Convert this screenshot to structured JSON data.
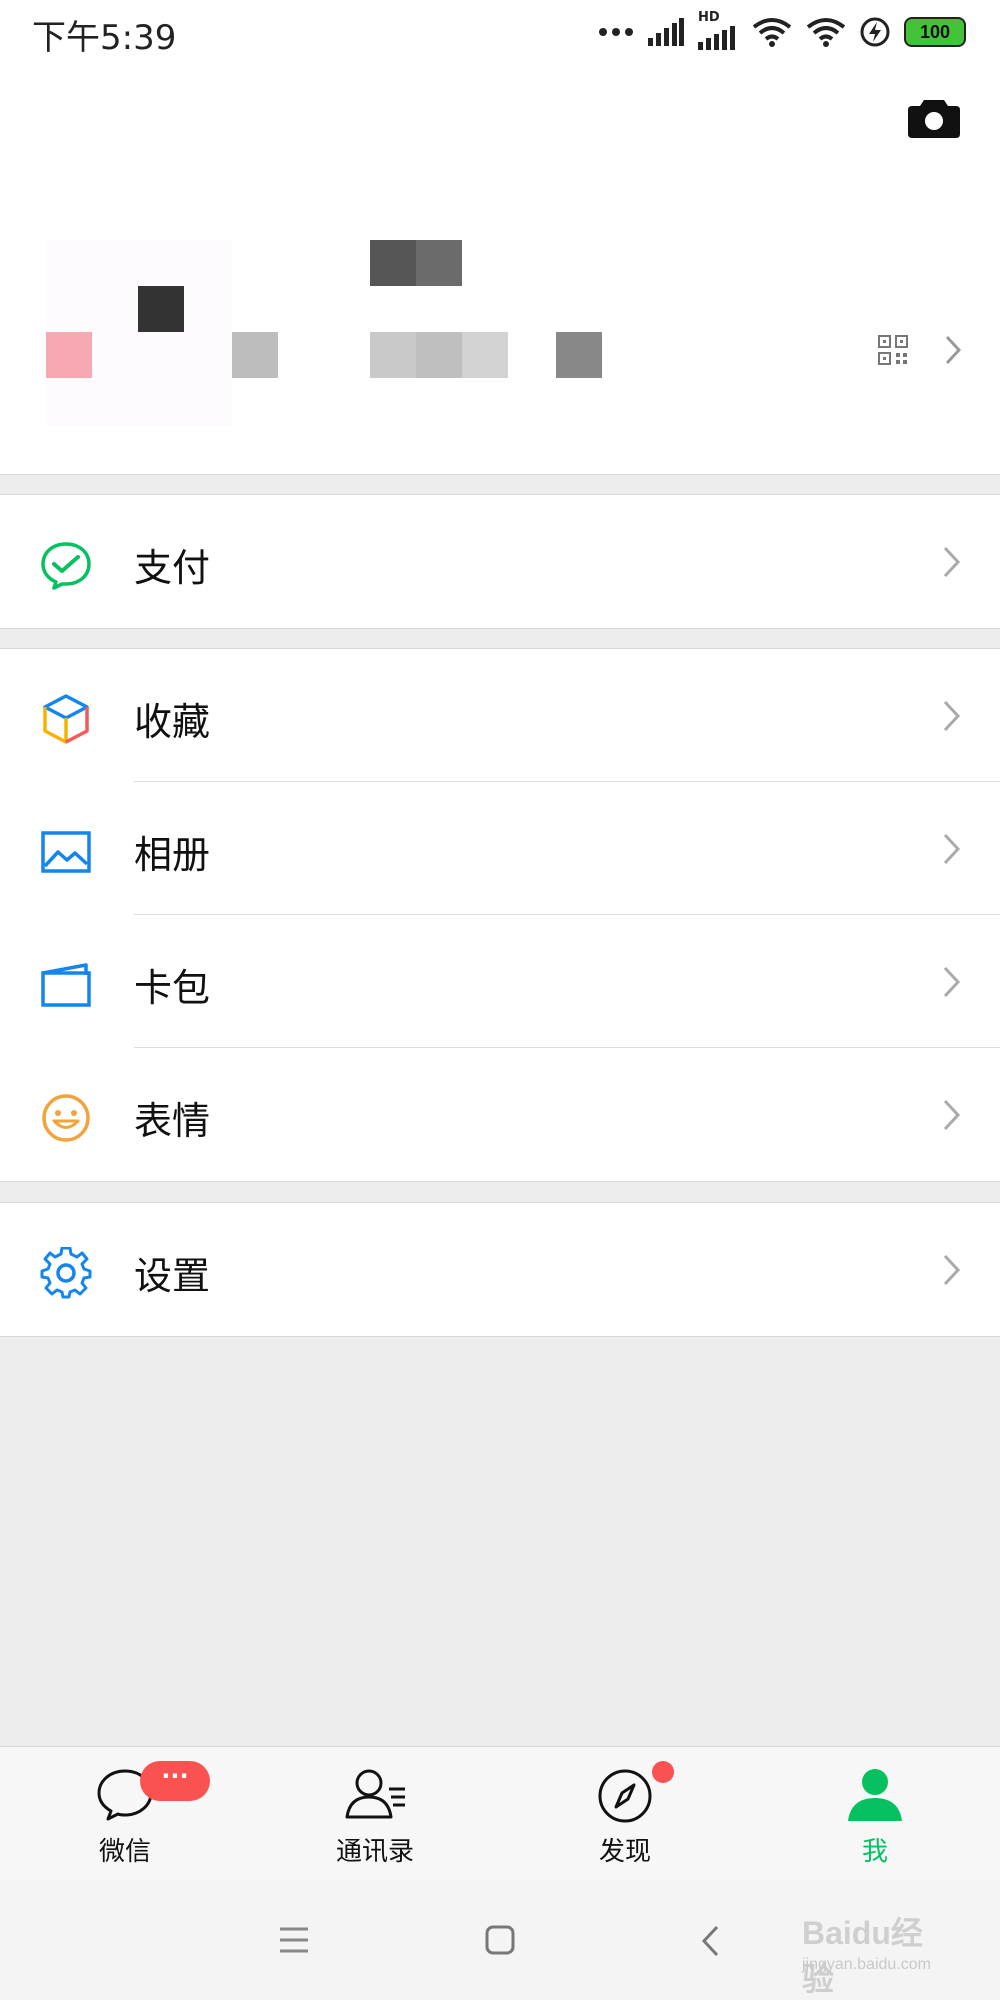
{
  "status_bar": {
    "time": "下午5:39",
    "battery": "100",
    "network_badge": "HD",
    "icons": [
      "more-dots-icon",
      "signal-icon",
      "hd-signal-icon",
      "wifi-icon",
      "wifi-link-icon",
      "charging-icon",
      "battery-icon"
    ]
  },
  "header": {
    "camera_icon": "camera-icon",
    "qr_icon": "qr-code-icon"
  },
  "menu_groups": [
    {
      "items": [
        {
          "label": "支付",
          "icon": "wechat-pay-icon",
          "color": "#07c160"
        }
      ]
    },
    {
      "items": [
        {
          "label": "收藏",
          "icon": "favorites-cube-icon",
          "color": "#f3b300"
        },
        {
          "label": "相册",
          "icon": "album-icon",
          "color": "#1485ee"
        },
        {
          "label": "卡包",
          "icon": "card-wallet-icon",
          "color": "#1485ee"
        },
        {
          "label": "表情",
          "icon": "sticker-smiley-icon",
          "color": "#f1a33c"
        }
      ]
    },
    {
      "items": [
        {
          "label": "设置",
          "icon": "settings-gear-icon",
          "color": "#1485ee"
        }
      ]
    }
  ],
  "tabs": [
    {
      "label": "微信",
      "icon": "chat-bubble-icon",
      "badge": "···"
    },
    {
      "label": "通讯录",
      "icon": "contacts-icon"
    },
    {
      "label": "发现",
      "icon": "compass-icon",
      "dot": true
    },
    {
      "label": "我",
      "icon": "me-person-icon",
      "active": true
    }
  ],
  "system_nav": [
    "menu-icon",
    "home-icon",
    "back-icon"
  ],
  "watermark": {
    "main": "Baidu经验",
    "sub": "jingyan.baidu.com"
  },
  "colors": {
    "accent": "#07c160",
    "badge": "#fa5151",
    "background": "#ededed"
  }
}
